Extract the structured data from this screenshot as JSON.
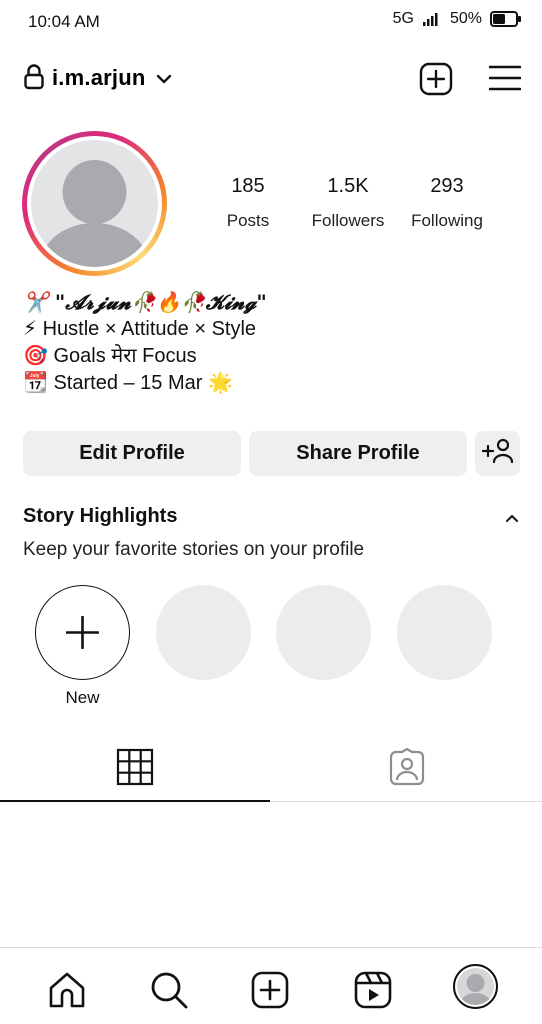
{
  "status_bar": {
    "time": "10:04 AM",
    "network": "5G",
    "battery": "50%"
  },
  "header": {
    "username": "i.m.arjun"
  },
  "stats": [
    {
      "value": "185",
      "label": "Posts"
    },
    {
      "value": "1.5K",
      "label": "Followers"
    },
    {
      "value": "293",
      "label": "Following"
    }
  ],
  "bio": {
    "line1": "✂️ \"𝓐𝓻𝓳𝓾𝓷🥀🔥🥀𝓚𝓲𝓷𝓰\"",
    "line2": "⚡ Hustle × Attitude × Style",
    "line3": "🎯 Goals मेरा Focus",
    "line4": "📆 Started – 15 Mar 🌟"
  },
  "buttons": {
    "edit_profile": "Edit Profile",
    "share_profile": "Share Profile"
  },
  "highlights": {
    "title": "Story Highlights",
    "subtitle": "Keep your favorite stories on your profile",
    "new_label": "New"
  },
  "icons": {
    "lock": "lock-icon",
    "chevron": "chevron-down-icon",
    "new_post": "plus-square-icon",
    "menu": "hamburger-menu-icon",
    "add_person": "add-person-icon",
    "grid": "grid-icon",
    "tagged": "tagged-person-icon",
    "home": "home-icon",
    "search": "search-icon",
    "create": "create-icon",
    "reels": "reels-icon"
  },
  "colors": {
    "button_bg": "#efefef",
    "ring_start": "#f58529",
    "ring_end": "#dd2a7b",
    "avatar_placeholder": "#e3e4e6"
  }
}
